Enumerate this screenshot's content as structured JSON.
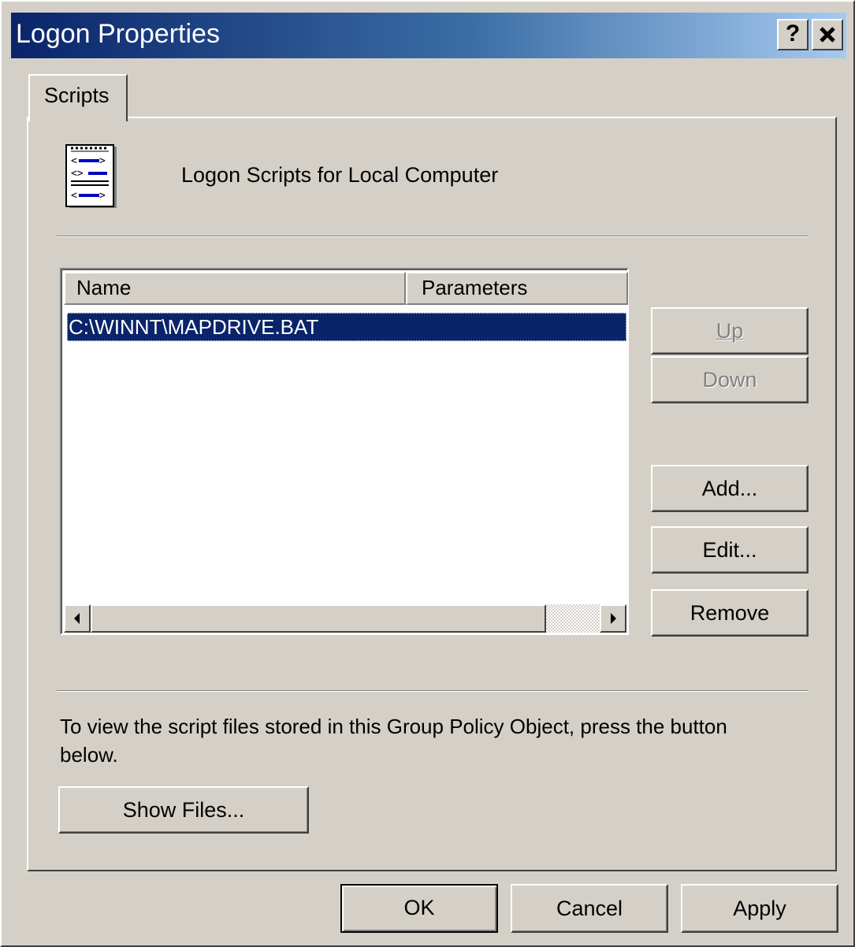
{
  "window": {
    "title": "Logon Properties",
    "help_button": "?",
    "close_button": "✕"
  },
  "tabs": [
    {
      "label": "Scripts",
      "selected": true
    }
  ],
  "header": {
    "icon": "script-file-icon",
    "label": "Logon Scripts for Local Computer"
  },
  "list": {
    "columns": [
      "Name",
      "Parameters"
    ],
    "rows": [
      {
        "name": "C:\\WINNT\\MAPDRIVE.BAT",
        "parameters": "",
        "selected": true
      }
    ],
    "scroll_left": "◀",
    "scroll_right": "▶"
  },
  "side_buttons": {
    "up": {
      "label": "Up",
      "mnemonic": "U",
      "enabled": false
    },
    "down": {
      "label": "Down",
      "mnemonic": "w",
      "enabled": false
    },
    "add": {
      "label": "Add...",
      "mnemonic": "d",
      "enabled": true
    },
    "edit": {
      "label": "Edit...",
      "mnemonic": "E",
      "enabled": true
    },
    "remove": {
      "label": "Remove",
      "mnemonic": "R",
      "enabled": true
    }
  },
  "info": {
    "text": "To view the script files stored in this Group Policy Object, press the button below."
  },
  "show_files_button": {
    "label": "Show Files...",
    "mnemonic": "S"
  },
  "footer": {
    "ok": "OK",
    "cancel": "Cancel",
    "apply": {
      "label": "Apply",
      "mnemonic": "A"
    }
  },
  "colors": {
    "dialog_face": "#d4d0c8",
    "title_start": "#0a246a",
    "title_end": "#a6caf0",
    "selection": "#0a246a"
  }
}
